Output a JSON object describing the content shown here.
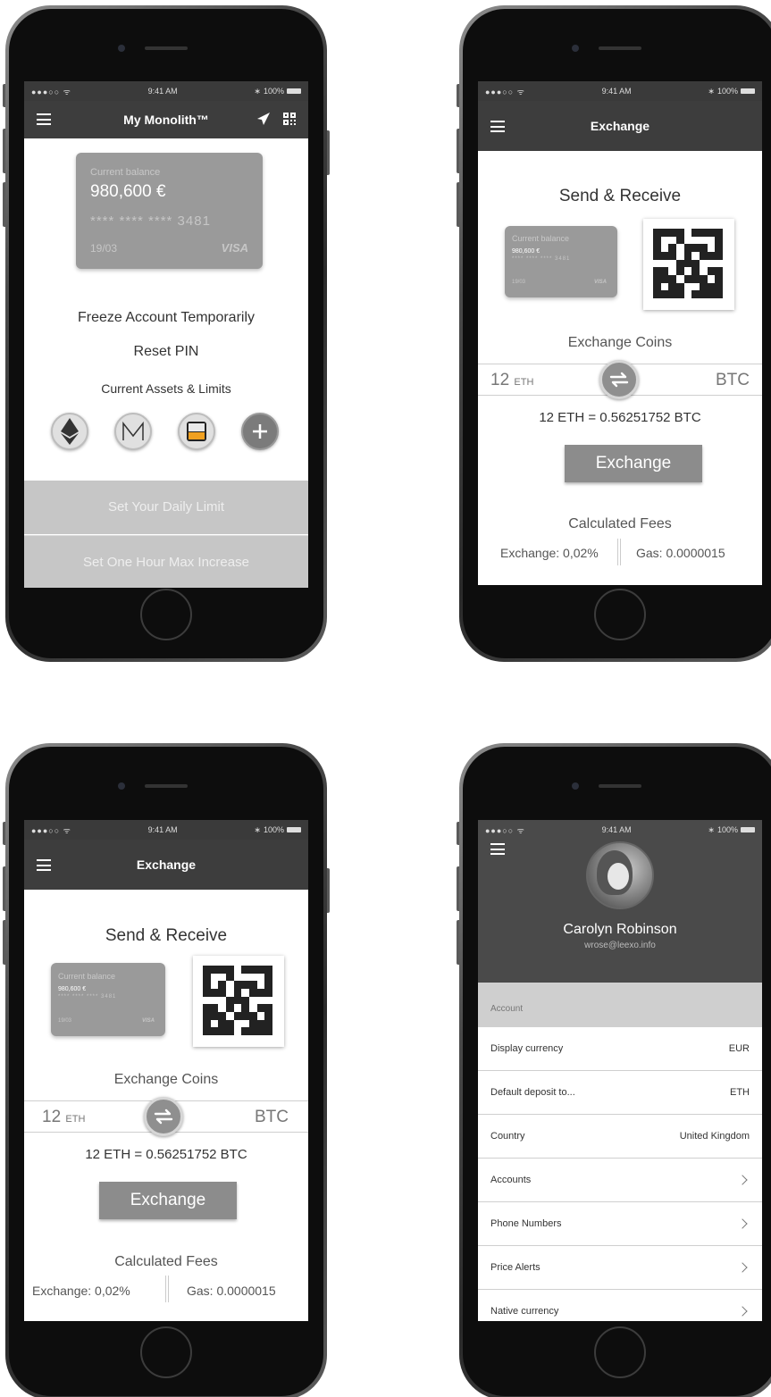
{
  "status": {
    "time": "9:41 AM",
    "battery": "100%"
  },
  "screen1": {
    "title": "My Monolith™",
    "card": {
      "label": "Current balance",
      "amount": "980,600 €",
      "number": "**** **** **** 3481",
      "expiry": "19/03",
      "brand": "VISA"
    },
    "freeze": "Freeze Account Temporarily",
    "reset_pin": "Reset PIN",
    "assets_title": "Current Assets & Limits",
    "assets": [
      "ethereum-icon",
      "monolith-icon",
      "first-blood-icon",
      "add-icon"
    ],
    "daily_limit": "Set Your Daily Limit",
    "hour_max": "Set One Hour Max Increase"
  },
  "exchange": {
    "title": "Exchange",
    "heading": "Send & Receive",
    "card": {
      "label": "Current balance",
      "amount": "980,600 €",
      "number": "**** **** **** 3481",
      "expiry": "19/03",
      "brand": "VISA"
    },
    "coins_title": "Exchange Coins",
    "from_amount": "12",
    "from_unit": "ETH",
    "to_unit": "BTC",
    "rate": "12 ETH = 0.56251752 BTC",
    "button": "Exchange",
    "fees_title": "Calculated Fees",
    "fee_exchange": "Exchange: 0,02%",
    "fee_gas": "Gas: 0.0000015"
  },
  "profile": {
    "name": "Carolyn Robinson",
    "email": "wrose@leexo.info",
    "section": "Account",
    "rows": [
      {
        "label": "Display currency",
        "value": "EUR"
      },
      {
        "label": "Default deposit to...",
        "value": "ETH"
      },
      {
        "label": "Country",
        "value": "United Kingdom"
      },
      {
        "label": "Accounts",
        "value": ""
      },
      {
        "label": "Phone Numbers",
        "value": ""
      },
      {
        "label": "Price Alerts",
        "value": ""
      },
      {
        "label": "Native currency",
        "value": ""
      }
    ]
  }
}
